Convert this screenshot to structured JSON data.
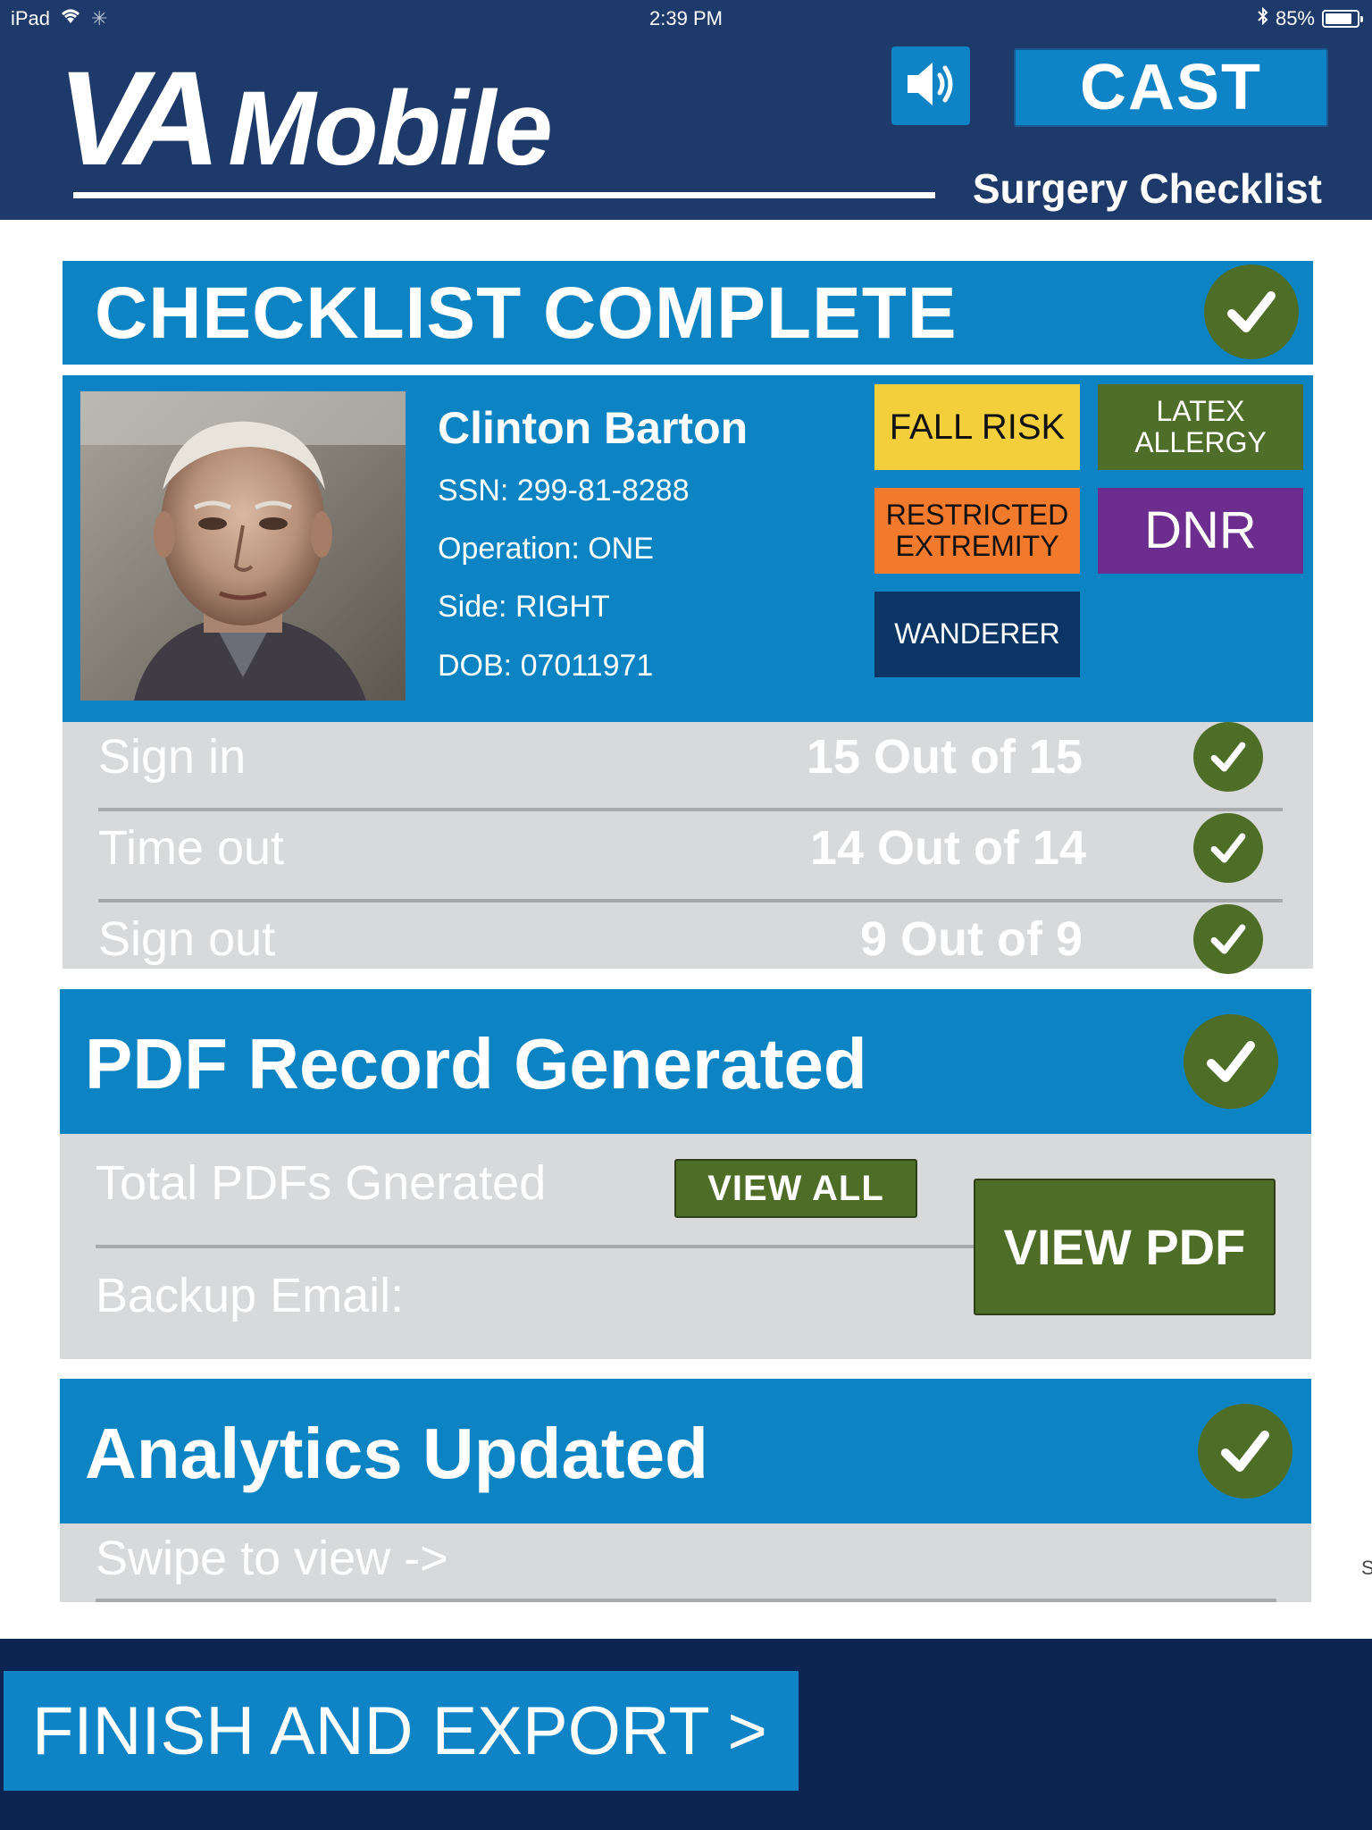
{
  "status_bar": {
    "device": "iPad",
    "time": "2:39 PM",
    "battery": "85%",
    "battery_level": 0.85,
    "icons": [
      "wifi-icon",
      "activity-spinner-icon",
      "bluetooth-icon",
      "battery-icon"
    ]
  },
  "header": {
    "logo_va": "VA",
    "logo_mobile": "Mobile",
    "subtitle": "Surgery Checklist",
    "cast_label": "CAST",
    "speaker_icon": "speaker-icon"
  },
  "checklist": {
    "title": "CHECKLIST COMPLETE",
    "status_icon": "check-icon"
  },
  "patient": {
    "name": "Clinton Barton",
    "ssn": "SSN: 299-81-8288",
    "operation": "Operation: ONE",
    "side": "Side: RIGHT",
    "dob": "DOB: 07011971",
    "tags": [
      {
        "label": "FALL RISK",
        "bg": "#f4cf3c",
        "color": "#111111"
      },
      {
        "label": "LATEX ALLERGY",
        "bg": "#4f6e2a",
        "color": "#ffffff"
      },
      {
        "label": "RESTRICTED EXTREMITY",
        "bg": "#f27a2c",
        "color": "#111111"
      },
      {
        "label": "DNR",
        "bg": "#6c2d8f",
        "color": "#ffffff"
      },
      {
        "label": "WANDERER",
        "bg": "#0b3565",
        "color": "#ffffff"
      }
    ]
  },
  "progress": [
    {
      "label": "Sign in",
      "count": "15 Out of 15"
    },
    {
      "label": "Time out",
      "count": "14 Out of 14"
    },
    {
      "label": "Sign out",
      "count": "9 Out of 9"
    }
  ],
  "pdf": {
    "title": "PDF Record Generated",
    "total_label": "Total PDFs Gnerated",
    "view_all": "VIEW ALL",
    "backup_label": "Backup Email:",
    "view_pdf": "VIEW PDF"
  },
  "analytics": {
    "title": "Analytics Updated",
    "hint": "Swipe to view ->",
    "stray": "S"
  },
  "footer": {
    "finish_label": "FINISH AND EXPORT >"
  },
  "colors": {
    "navy": "#1e3a6b",
    "accent_blue": "#0c84c4",
    "check_green": "#4e6e27",
    "panel_gray": "#d8d9da",
    "footer_navy": "#0b2452"
  }
}
